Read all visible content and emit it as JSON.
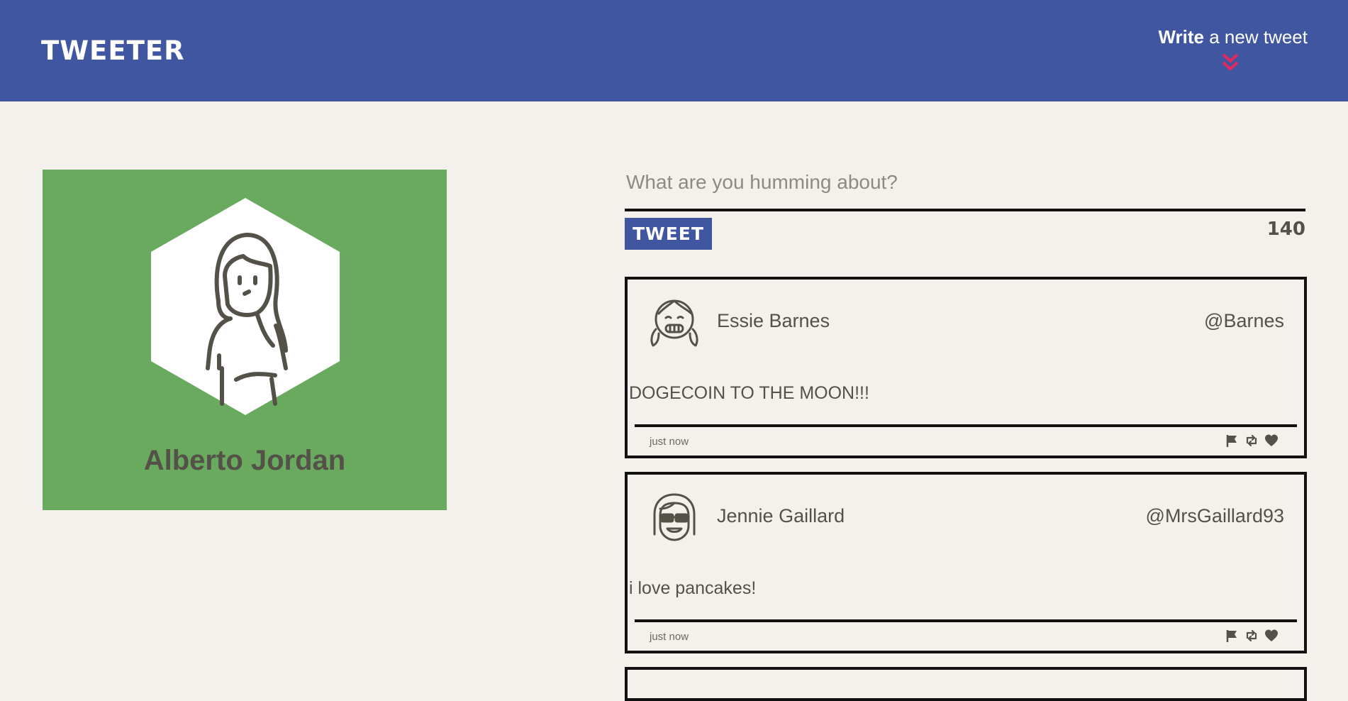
{
  "header": {
    "brand": "TWEETER",
    "compose_strong": "Write",
    "compose_rest": " a new tweet",
    "accent_color": "#e5285e",
    "bar_color": "#4056a1"
  },
  "profile": {
    "name": "Alberto Jordan",
    "card_color": "#6aaa5f",
    "avatar_icon": "woman-avatar-icon"
  },
  "composer": {
    "placeholder": "What are you humming about?",
    "button_label": "TWEET",
    "counter": "140"
  },
  "tweets": [
    {
      "author": "Essie Barnes",
      "handle": "@Barnes",
      "text": "DOGECOIN TO THE MOON!!!",
      "time": "just now",
      "avatar_icon": "girl-pigtails-avatar-icon",
      "actions": [
        "flag-icon",
        "retweet-icon",
        "heart-icon"
      ]
    },
    {
      "author": "Jennie Gaillard",
      "handle": "@MrsGaillard93",
      "text": "i love pancakes!",
      "time": "just now",
      "avatar_icon": "girl-sunglasses-avatar-icon",
      "actions": [
        "flag-icon",
        "retweet-icon",
        "heart-icon"
      ]
    }
  ]
}
